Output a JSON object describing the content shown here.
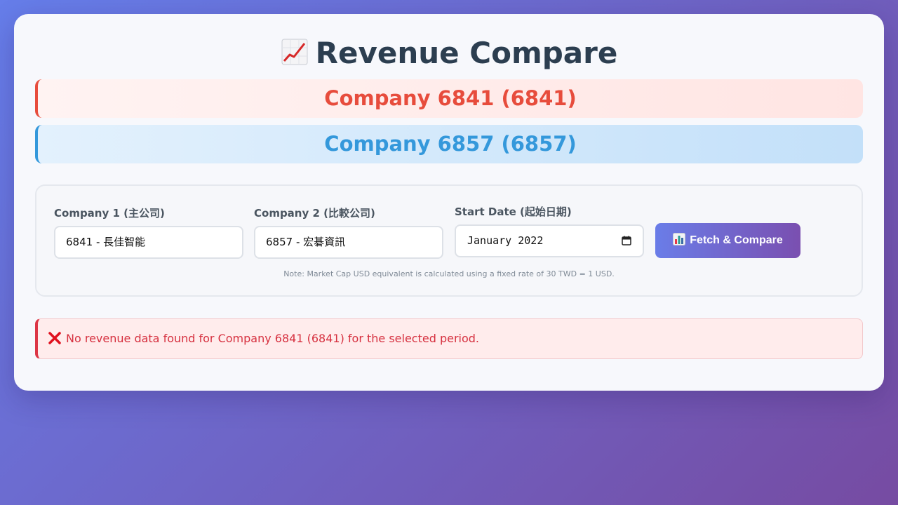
{
  "app": {
    "title": "Revenue Compare",
    "title_icon": "chart-increasing-icon"
  },
  "companies": {
    "primary": {
      "label": "Company 6841 (6841)",
      "color": "#e74c3c"
    },
    "compare": {
      "label": "Company 6857 (6857)",
      "color": "#3498db"
    }
  },
  "form": {
    "company1": {
      "label": "Company 1 (主公司)",
      "value": "6841 - 長佳智能"
    },
    "company2": {
      "label": "Company 2 (比較公司)",
      "value": "6857 - 宏碁資訊"
    },
    "start_date": {
      "label": "Start Date (起始日期)",
      "value": "January 2022",
      "icon": "calendar-icon"
    },
    "fetch_button": {
      "label": "Fetch & Compare",
      "icon": "bar-chart-icon"
    },
    "note": "Note: Market Cap USD equivalent is calculated using a fixed rate of 30 TWD = 1 USD."
  },
  "error": {
    "icon": "cross-mark-icon",
    "message": "No revenue data found for Company 6841 (6841) for the selected period.",
    "color": "#dc3545"
  },
  "theme": {
    "gradient_start": "#667eea",
    "gradient_end": "#764ba2"
  }
}
